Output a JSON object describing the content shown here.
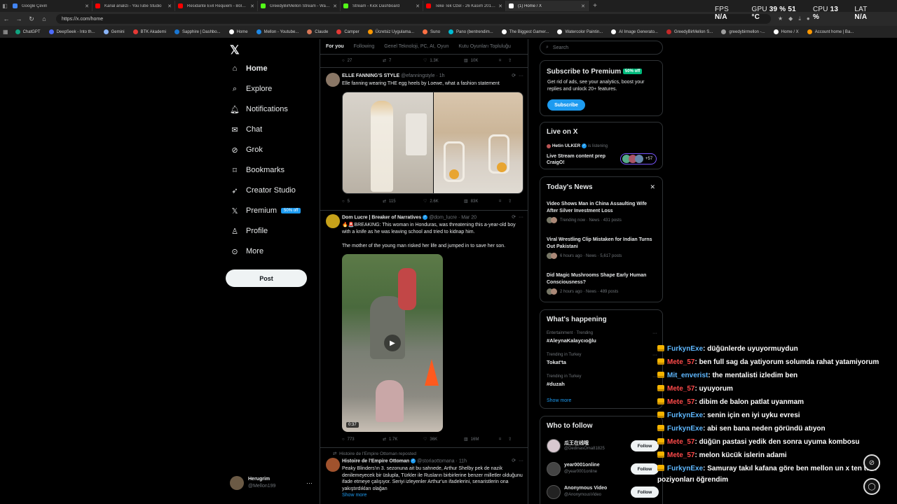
{
  "browser": {
    "tabs": [
      {
        "title": "Google Çeviri",
        "color": "#4285f4"
      },
      {
        "title": "Kanal analizi - YouTube Studio",
        "color": "#ff0000"
      },
      {
        "title": "Residante Evil Requiem - Bölüm 4",
        "color": "#ff0000"
      },
      {
        "title": "GreedyBirMellon Stream - Watch",
        "color": "#53fc18"
      },
      {
        "title": "Stream - Kick Dashboard",
        "color": "#53fc18"
      },
      {
        "title": "Teke Tek Özel - 26 Kasım 2017 \"Cr",
        "color": "#ff0000"
      },
      {
        "title": "(1) Home / X",
        "color": "#ffffff"
      }
    ],
    "url": "https://x.com/home",
    "bookmarks": [
      "ChatGPT",
      "DeepSeek - Into th...",
      "Gemini",
      "BTK Akademi",
      "Sapphire | Dashbo...",
      "Home",
      "Mellon - Youtube...",
      "Claude",
      "Camper",
      "Ücretsiz Uygulama...",
      "Suno",
      "Pano (bentrendim...",
      "The Biggest Gamer...",
      "Watercolor Paintin...",
      "AI Image Generato...",
      "GreedyBirMellon S...",
      "greedybirmellon -...",
      "Home / X",
      "Account home | Ba..."
    ],
    "bookmark_colors": [
      "#10a37f",
      "#4d6bfe",
      "#8ab4f8",
      "#e53935",
      "#1976d2",
      "#ffffff",
      "#1e88e5",
      "#d97757",
      "#e53935",
      "#ff9800",
      "#ff7043",
      "#00bcd4",
      "#ffffff",
      "#ffffff",
      "#ffffff",
      "#c62828",
      "#9e9e9e",
      "#ffffff",
      "#ff9800"
    ]
  },
  "perf": {
    "fps_label": "FPS",
    "fps": "N/A",
    "gpu_label": "GPU",
    "gpu": "39 % 51 °C",
    "cpu_label": "CPU",
    "cpu": "13 %",
    "lat_label": "LAT",
    "lat": "N/A"
  },
  "nav": {
    "items": [
      {
        "label": "Home",
        "icon": "home-icon"
      },
      {
        "label": "Explore",
        "icon": "search-icon"
      },
      {
        "label": "Notifications",
        "icon": "bell-icon"
      },
      {
        "label": "Chat",
        "icon": "mail-icon"
      },
      {
        "label": "Grok",
        "icon": "grok-icon"
      },
      {
        "label": "Bookmarks",
        "icon": "bookmark-icon"
      },
      {
        "label": "Creator Studio",
        "icon": "rocket-icon"
      },
      {
        "label": "Premium",
        "icon": "x-icon"
      },
      {
        "label": "Profile",
        "icon": "person-icon"
      },
      {
        "label": "More",
        "icon": "more-circle-icon"
      }
    ],
    "premium_badge": "50% off",
    "post_button": "Post",
    "account": {
      "name": "Herugrim",
      "handle": "@Mellon199"
    }
  },
  "feed": {
    "tabs": [
      "For you",
      "Following",
      "Genel Teknoloji, PC, AI, Oyun",
      "Kutu Oyunları Topluluğu"
    ],
    "top_actions": {
      "replies": "27",
      "reposts": "7",
      "likes": "1.3K",
      "views": "10K"
    },
    "tweets": [
      {
        "name": "ELLE FANNING'S STYLE",
        "handle": "@efanningstyle",
        "time": "1h",
        "text": "Elle fanning wearing THE egg heels by Loewe, what a fashion statement",
        "replies": "5",
        "reposts": "115",
        "likes": "2.6K",
        "views": "83K"
      },
      {
        "name": "Dom Lucre | Breaker of Narratives",
        "handle": "@dom_lucre",
        "time": "Mar 20",
        "text": "🔥🚨BREAKING: This woman in Honduras, was threatening this a-year-old boy with a knife as he was leaving school and tried to kidnap him.",
        "text2": "The mother of the young man risked her life and jumped in to save her son.",
        "duration": "0:37",
        "replies": "773",
        "reposts": "1.7K",
        "likes": "36K",
        "views": "16M"
      },
      {
        "repost_label": "Histoire de l'Empire Ottoman reposted",
        "name": "Histoire de l'Empire Ottoman",
        "handle": "@storiaottomana",
        "time": "11h",
        "text": "Peaky Blinders'ın 3. sezonuna ait bu sahnede, Arthur Shelby pek de nazik denilemeyecek bir üslupla, Türkler ile Rusların birbirlerine benzer milletler olduğunu ifade etmeye çalışıyor. Seriyi izleyenler Arthur'un ifadelerini, senaristlerin ona yakıştırdıkları olağan",
        "show_more": "Show more"
      }
    ]
  },
  "sidebar": {
    "search_placeholder": "Search",
    "premium": {
      "title": "Subscribe to Premium",
      "badge": "50% off",
      "text": "Get rid of ads, see your analytics, boost your replies and unlock 20+ features.",
      "button": "Subscribe"
    },
    "live": {
      "title": "Live on X",
      "host": "Hetin ULKER",
      "status": "is listening",
      "stream": "Live Stream content prep CraigO!",
      "count": "+57"
    },
    "news": {
      "title": "Today's News",
      "items": [
        {
          "headline": "Video Shows Man in China Assaulting Wife After Silver Investment Loss",
          "meta": "Trending now · News · 431 posts"
        },
        {
          "headline": "Viral Wrestling Clip Mistaken for Indian Turns Out Pakistani",
          "meta": "6 hours ago · News · 5,617 posts"
        },
        {
          "headline": "Did Magic Mushrooms Shape Early Human Consciousness?",
          "meta": "2 hours ago · News · 489 posts"
        }
      ]
    },
    "happening": {
      "title": "What's happening",
      "items": [
        {
          "context": "Entertainment · Trending",
          "topic": "#AleynaKalaycıoğlu"
        },
        {
          "context": "Trending in Turkey",
          "topic": "Tokat'ta"
        },
        {
          "context": "Trending in Turkey",
          "topic": "#duzah"
        }
      ],
      "show_more": "Show more"
    },
    "follow": {
      "title": "Who to follow",
      "button": "Follow",
      "items": [
        {
          "name": "瓜王在线哦",
          "handle": "@DedinasOma81825"
        },
        {
          "name": "year0001online",
          "handle": "@year0001online"
        },
        {
          "name": "Anonymous Video",
          "handle": "@AnonymousVideo"
        }
      ]
    }
  },
  "chat": {
    "colors": {
      "FurkynExe": "#5fb8ff",
      "Mete_57": "#ff4a4a",
      "Mit_enverist": "#5fb8ff"
    },
    "lines": [
      {
        "user": "FurkynExe",
        "msg": ": düğünlerde uyuyormuydun"
      },
      {
        "user": "Mete_57",
        "msg": ": ben full sag da yatiyorum solumda rahat yatamiyorum"
      },
      {
        "user": "Mit_enverist",
        "msg": ": the mentalisti izledim ben"
      },
      {
        "user": "Mete_57",
        "msg": ": uyuyorum"
      },
      {
        "user": "Mete_57",
        "msg": ": dibim de balon patlat uyanmam"
      },
      {
        "user": "FurkynExe",
        "msg": ": senin için en iyi uyku evresi"
      },
      {
        "user": "FurkynExe",
        "msg": ": abi sen bana neden göründü atıyon"
      },
      {
        "user": "Mete_57",
        "msg": ": düğün pastasi yedik den sonra uyuma kombosu"
      },
      {
        "user": "Mete_57",
        "msg": ": melon kücük islerin adami"
      },
      {
        "user": "FurkynExe",
        "msg": ": Samuray takıl kafana göre ben mellon un x ten tüm poziyonları öğrendim"
      }
    ]
  }
}
